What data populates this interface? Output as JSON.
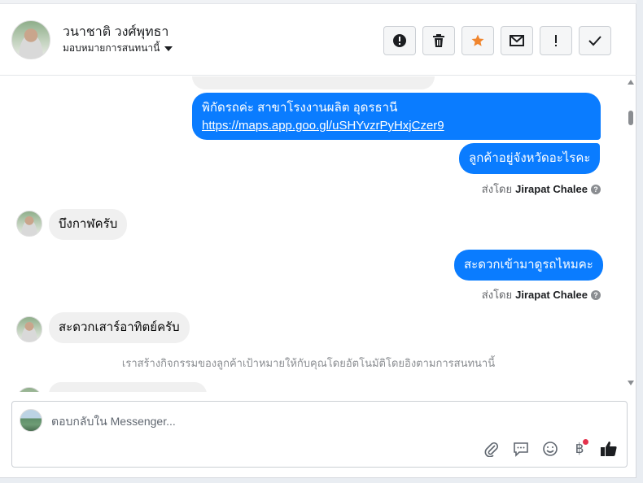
{
  "header": {
    "contact_name": "วนาชาติ วงศ์พุทธา",
    "assignment_label": "มอบหมายการสนทนานี้"
  },
  "actions": [
    {
      "name": "mark-spam-button",
      "icon": "alert-circle-icon"
    },
    {
      "name": "delete-button",
      "icon": "trash-icon"
    },
    {
      "name": "star-button",
      "icon": "star-icon",
      "color": "#f0852d"
    },
    {
      "name": "mark-unread-button",
      "icon": "envelope-icon"
    },
    {
      "name": "follow-up-button",
      "icon": "exclamation-icon"
    },
    {
      "name": "mark-done-button",
      "icon": "check-icon"
    }
  ],
  "messages": {
    "out_1_text": "พิกัดรถค่ะ สาขาโรงงานผลิต อุดรธานี",
    "out_1_link": "https://maps.app.goo.gl/uSHYvzrPyHxjCzer9",
    "out_2_text": "ลูกค้าอยู่จังหวัดอะไรคะ",
    "sent_by_prefix": "ส่งโดย",
    "sent_by_name": "Jirapat Chalee",
    "in_1_text": "บึงกาฬครับ",
    "out_3_text": "สะดวกเข้ามาดูรถไหมคะ",
    "in_2_text": "สะดวกเสาร์อาทิตย์ครับ",
    "system_note": "เราสร้างกิจกรรมของลูกค้าเป้าหมายให้กับคุณโดยอัตโนมัติโดยอิงตามการสนทนานี้"
  },
  "composer": {
    "placeholder": "ตอบกลับใน Messenger...",
    "tools": [
      "paperclip-icon",
      "saved-reply-icon",
      "emoji-icon",
      "payment-icon",
      "like-icon"
    ]
  },
  "colors": {
    "outgoing_bubble": "#0a7cff",
    "incoming_bubble": "#f0f0f0",
    "star": "#f0852d",
    "notification_dot": "#e4324c"
  }
}
